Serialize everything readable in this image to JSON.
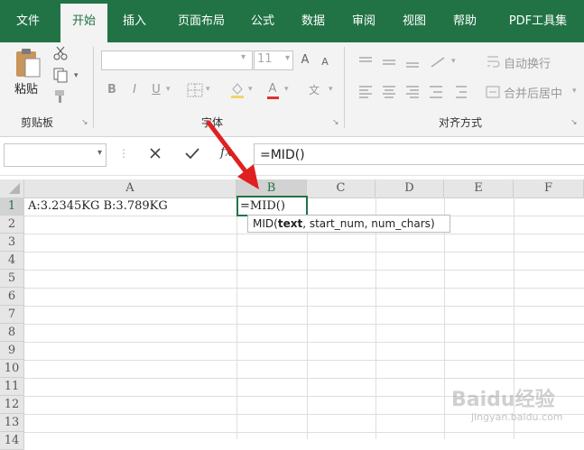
{
  "tabs": [
    "文件",
    "开始",
    "插入",
    "页面布局",
    "公式",
    "数据",
    "审阅",
    "视图",
    "帮助",
    "PDF工具集"
  ],
  "ribbon": {
    "paste_label": "粘贴",
    "clipboard_label": "剪贴板",
    "font_group_label": "字体",
    "align_group_label": "对齐方式",
    "font_size": "11",
    "bold": "B",
    "italic": "I",
    "underline": "U",
    "font_grow": "A",
    "font_shrink": "A",
    "font_color": "A",
    "phonetic": "文",
    "wrap_text": "自动换行",
    "merge_center": "合并后居中"
  },
  "formula_bar": {
    "name_box": "",
    "fx": "fx",
    "content": "=MID()"
  },
  "columns": [
    "A",
    "B",
    "C",
    "D",
    "E",
    "F"
  ],
  "rows": [
    "1",
    "2",
    "3",
    "4",
    "5",
    "6",
    "7",
    "8",
    "9",
    "10",
    "11",
    "12",
    "13",
    "14"
  ],
  "cells": {
    "A1": "A:3.2345KG   B:3.789KG",
    "B1": "=MID()"
  },
  "tooltip": {
    "func": "MID(",
    "arg1": "text",
    "rest": ", start_num, num_chars)"
  },
  "watermark": {
    "brand": "Baidu经验",
    "url": "jingyan.baidu.com"
  },
  "colors": {
    "excel_green": "#217346",
    "arrow_red": "#e02020",
    "selected_cell_border": "#217346"
  }
}
